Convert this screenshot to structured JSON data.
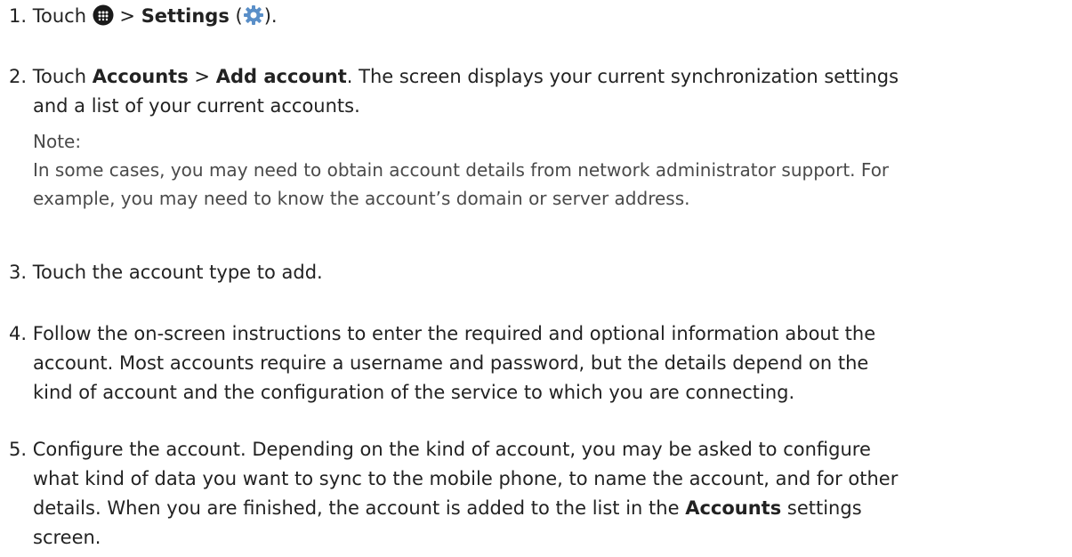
{
  "steps": [
    {
      "number": "1.",
      "parts": {
        "a": "Touch",
        "sep": ">",
        "settings": "Settings",
        "paren_open": "(",
        "paren_close": ")."
      },
      "icons": [
        "apps-icon",
        "settings-gear-icon"
      ]
    },
    {
      "number": "2.",
      "parts": {
        "a": "Touch",
        "accounts": "Accounts",
        "sep": ">",
        "add_account": "Add account",
        "rest_line1": ". The screen displays your current synchronization settings",
        "line2": "and a list of your current accounts."
      },
      "note": {
        "label": "Note:",
        "line1": "In some cases, you may need to obtain account details from network administrator support. For",
        "line2": "example, you may need to know the account’s domain or server address."
      }
    },
    {
      "number": "3.",
      "text": "Touch the account type to add."
    },
    {
      "number": "4.",
      "line1": "Follow the on-screen instructions to enter the required and optional information about the",
      "line2": "account. Most accounts require a username and password, but the details depend on the",
      "line3": "kind of account and the configuration of the service to which you are connecting."
    },
    {
      "number": "5.",
      "line1": "Configure the account. Depending on the kind of account, you may be asked to configure",
      "line2": "what kind of data you want to sync to the mobile phone, to name the account, and for other",
      "line3_a": "details. When you are finished, the account is added to the list in the",
      "line3_b": "Accounts",
      "line3_c": "settings",
      "line4": "screen."
    }
  ],
  "colors": {
    "text": "#222222",
    "note_text": "#4a4a4a",
    "apps_icon_bg": "#1a1a1a",
    "gear_icon": "#5a8fc8"
  }
}
